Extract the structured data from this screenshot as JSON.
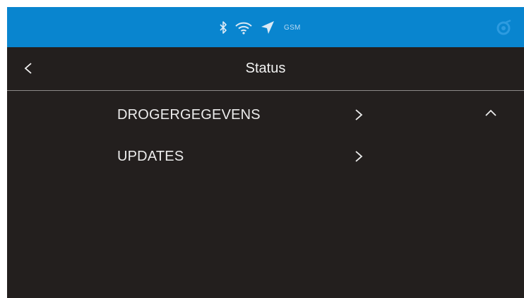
{
  "status_bar": {
    "background": "#0985cf",
    "icons": [
      "bluetooth-icon",
      "wifi-icon",
      "location-arrow-icon"
    ],
    "network_label": "GSM"
  },
  "header": {
    "title": "Status"
  },
  "menu": {
    "items": [
      {
        "label": "DROGERGEGEVENS",
        "icon": "chevron-right-icon"
      },
      {
        "label": "UPDATES",
        "icon": "chevron-right-icon"
      }
    ]
  },
  "colors": {
    "background": "#231f1e",
    "text": "#ececec",
    "divider": "#8c8a89"
  }
}
